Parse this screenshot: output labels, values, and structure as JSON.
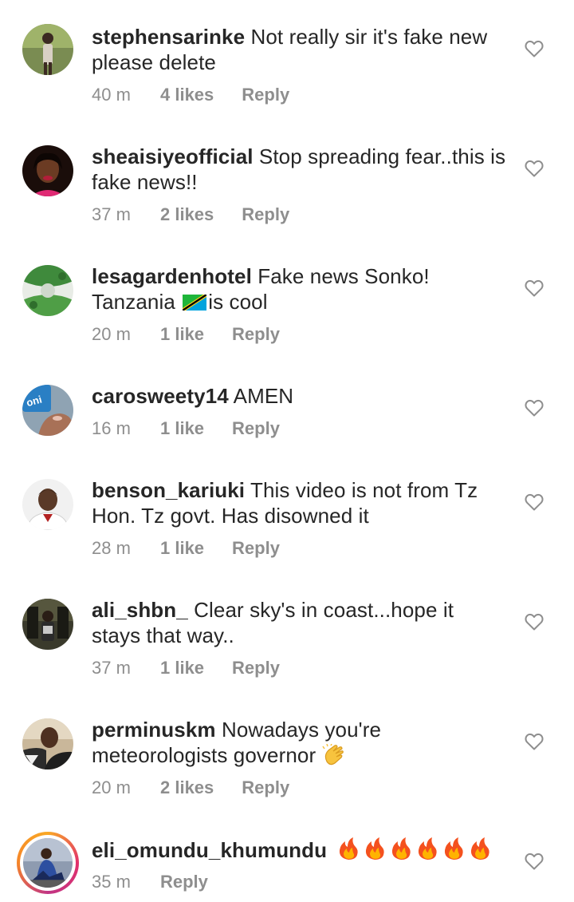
{
  "comments": [
    {
      "username": "stephensarinke",
      "text_line1": "Not really sir it's fake new",
      "text_line2": "please delete",
      "time": "40 m",
      "likes": "4 likes",
      "reply": "Reply"
    },
    {
      "username": "sheaisiyeofficial",
      "text_line1": "Stop spreading fear..this is",
      "text_line2": "fake news!!",
      "time": "37 m",
      "likes": "2 likes",
      "reply": "Reply"
    },
    {
      "username": "lesagardenhotel",
      "text_line1": "Fake news Sonko!",
      "text_line2a": "Tanzania",
      "text_line2b": "is cool",
      "time": "20 m",
      "likes": "1 like",
      "reply": "Reply"
    },
    {
      "username": "carosweety14",
      "text_line1": "AMEN",
      "time": "16 m",
      "likes": "1 like",
      "reply": "Reply"
    },
    {
      "username": "benson_kariuki",
      "text_line1": "This video is not from Tz",
      "text_line2": "Hon. Tz govt. Has disowned it",
      "time": "28 m",
      "likes": "1 like",
      "reply": "Reply"
    },
    {
      "username": "ali_shbn_",
      "text_line1": "Clear sky's in coast...hope it",
      "text_line2": "stays that way..",
      "time": "37 m",
      "likes": "1 like",
      "reply": "Reply"
    },
    {
      "username": "perminuskm",
      "text_line1": "Nowadays  you're",
      "text_line2": "meteorologists  governor",
      "time": "20 m",
      "likes": "2 likes",
      "reply": "Reply"
    },
    {
      "username": "eli_omundu_khumundu",
      "emoji_text": "fire-emoji x6",
      "time": "35 m",
      "reply": "Reply"
    }
  ],
  "icons": {
    "like": "heart-outline-icon",
    "flag": "tanzania-flag-emoji",
    "clap": "clapping-hands-emoji",
    "fire": "fire-emoji"
  },
  "colors": {
    "text": "#262626",
    "meta": "#8e8e8e",
    "heart": "#8e8e8e"
  }
}
